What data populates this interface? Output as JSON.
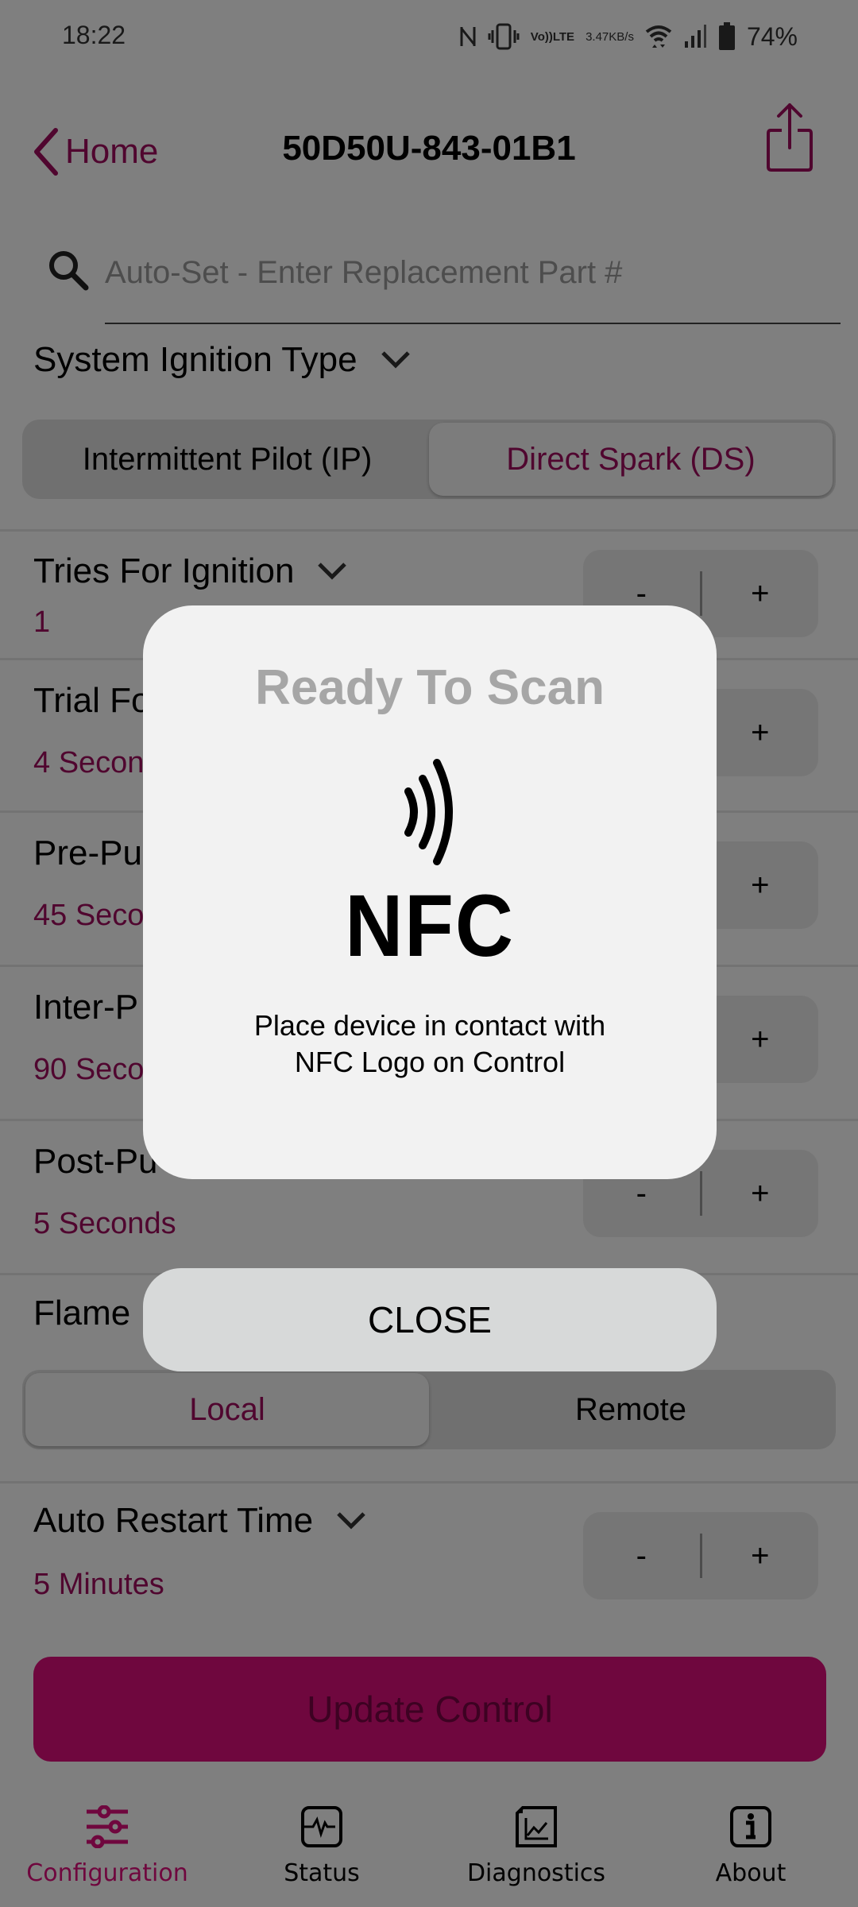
{
  "status_bar": {
    "time": "18:22",
    "network_speed_value": "3.47",
    "network_speed_unit": "KB/s",
    "volte_top": "Vo))",
    "volte_bottom": "LTE",
    "battery_percent": "74%",
    "icons": [
      "nfc-icon",
      "vibrate-icon",
      "volte-icon",
      "wifi-icon",
      "signal-icon",
      "battery-icon"
    ]
  },
  "header": {
    "back_label": "Home",
    "title": "50D50U-843-01B1",
    "share_icon": "share-icon"
  },
  "search": {
    "placeholder": "Auto-Set - Enter Replacement Part #",
    "value": ""
  },
  "ignition_type": {
    "label": "System Ignition Type",
    "options": [
      "Intermittent Pilot (IP)",
      "Direct Spark (DS)"
    ],
    "selected": "Direct Spark (DS)"
  },
  "settings": [
    {
      "label": "Tries For Ignition",
      "value": "1"
    },
    {
      "label": "Trial Fo",
      "value": "4 Secon"
    },
    {
      "label": "Pre-Pu",
      "value": "45 Seco"
    },
    {
      "label": "Inter-P",
      "value": "90 Seco"
    },
    {
      "label": "Post-Pu",
      "value": "5 Seconds"
    }
  ],
  "stepper": {
    "minus": "-",
    "plus": "+"
  },
  "flame": {
    "label": "Flame",
    "options": [
      "Local",
      "Remote"
    ],
    "selected": "Local"
  },
  "auto_restart": {
    "label": "Auto Restart Time",
    "value": "5 Minutes"
  },
  "update_button": "Update Control",
  "tabs": [
    {
      "label": "Configuration",
      "icon": "sliders-icon",
      "active": true
    },
    {
      "label": "Status",
      "icon": "pulse-icon",
      "active": false
    },
    {
      "label": "Diagnostics",
      "icon": "chart-document-icon",
      "active": false
    },
    {
      "label": "About",
      "icon": "info-icon",
      "active": false
    }
  ],
  "nfc_modal": {
    "title": "Ready To Scan",
    "logo_text": "NFC",
    "message_line1": "Place device in contact with",
    "message_line2": "NFC Logo on Control",
    "close_label": "CLOSE"
  },
  "colors": {
    "accent": "#a10d5e",
    "button": "#df0f7d",
    "scrim": "rgba(0,0,0,0.5)"
  }
}
